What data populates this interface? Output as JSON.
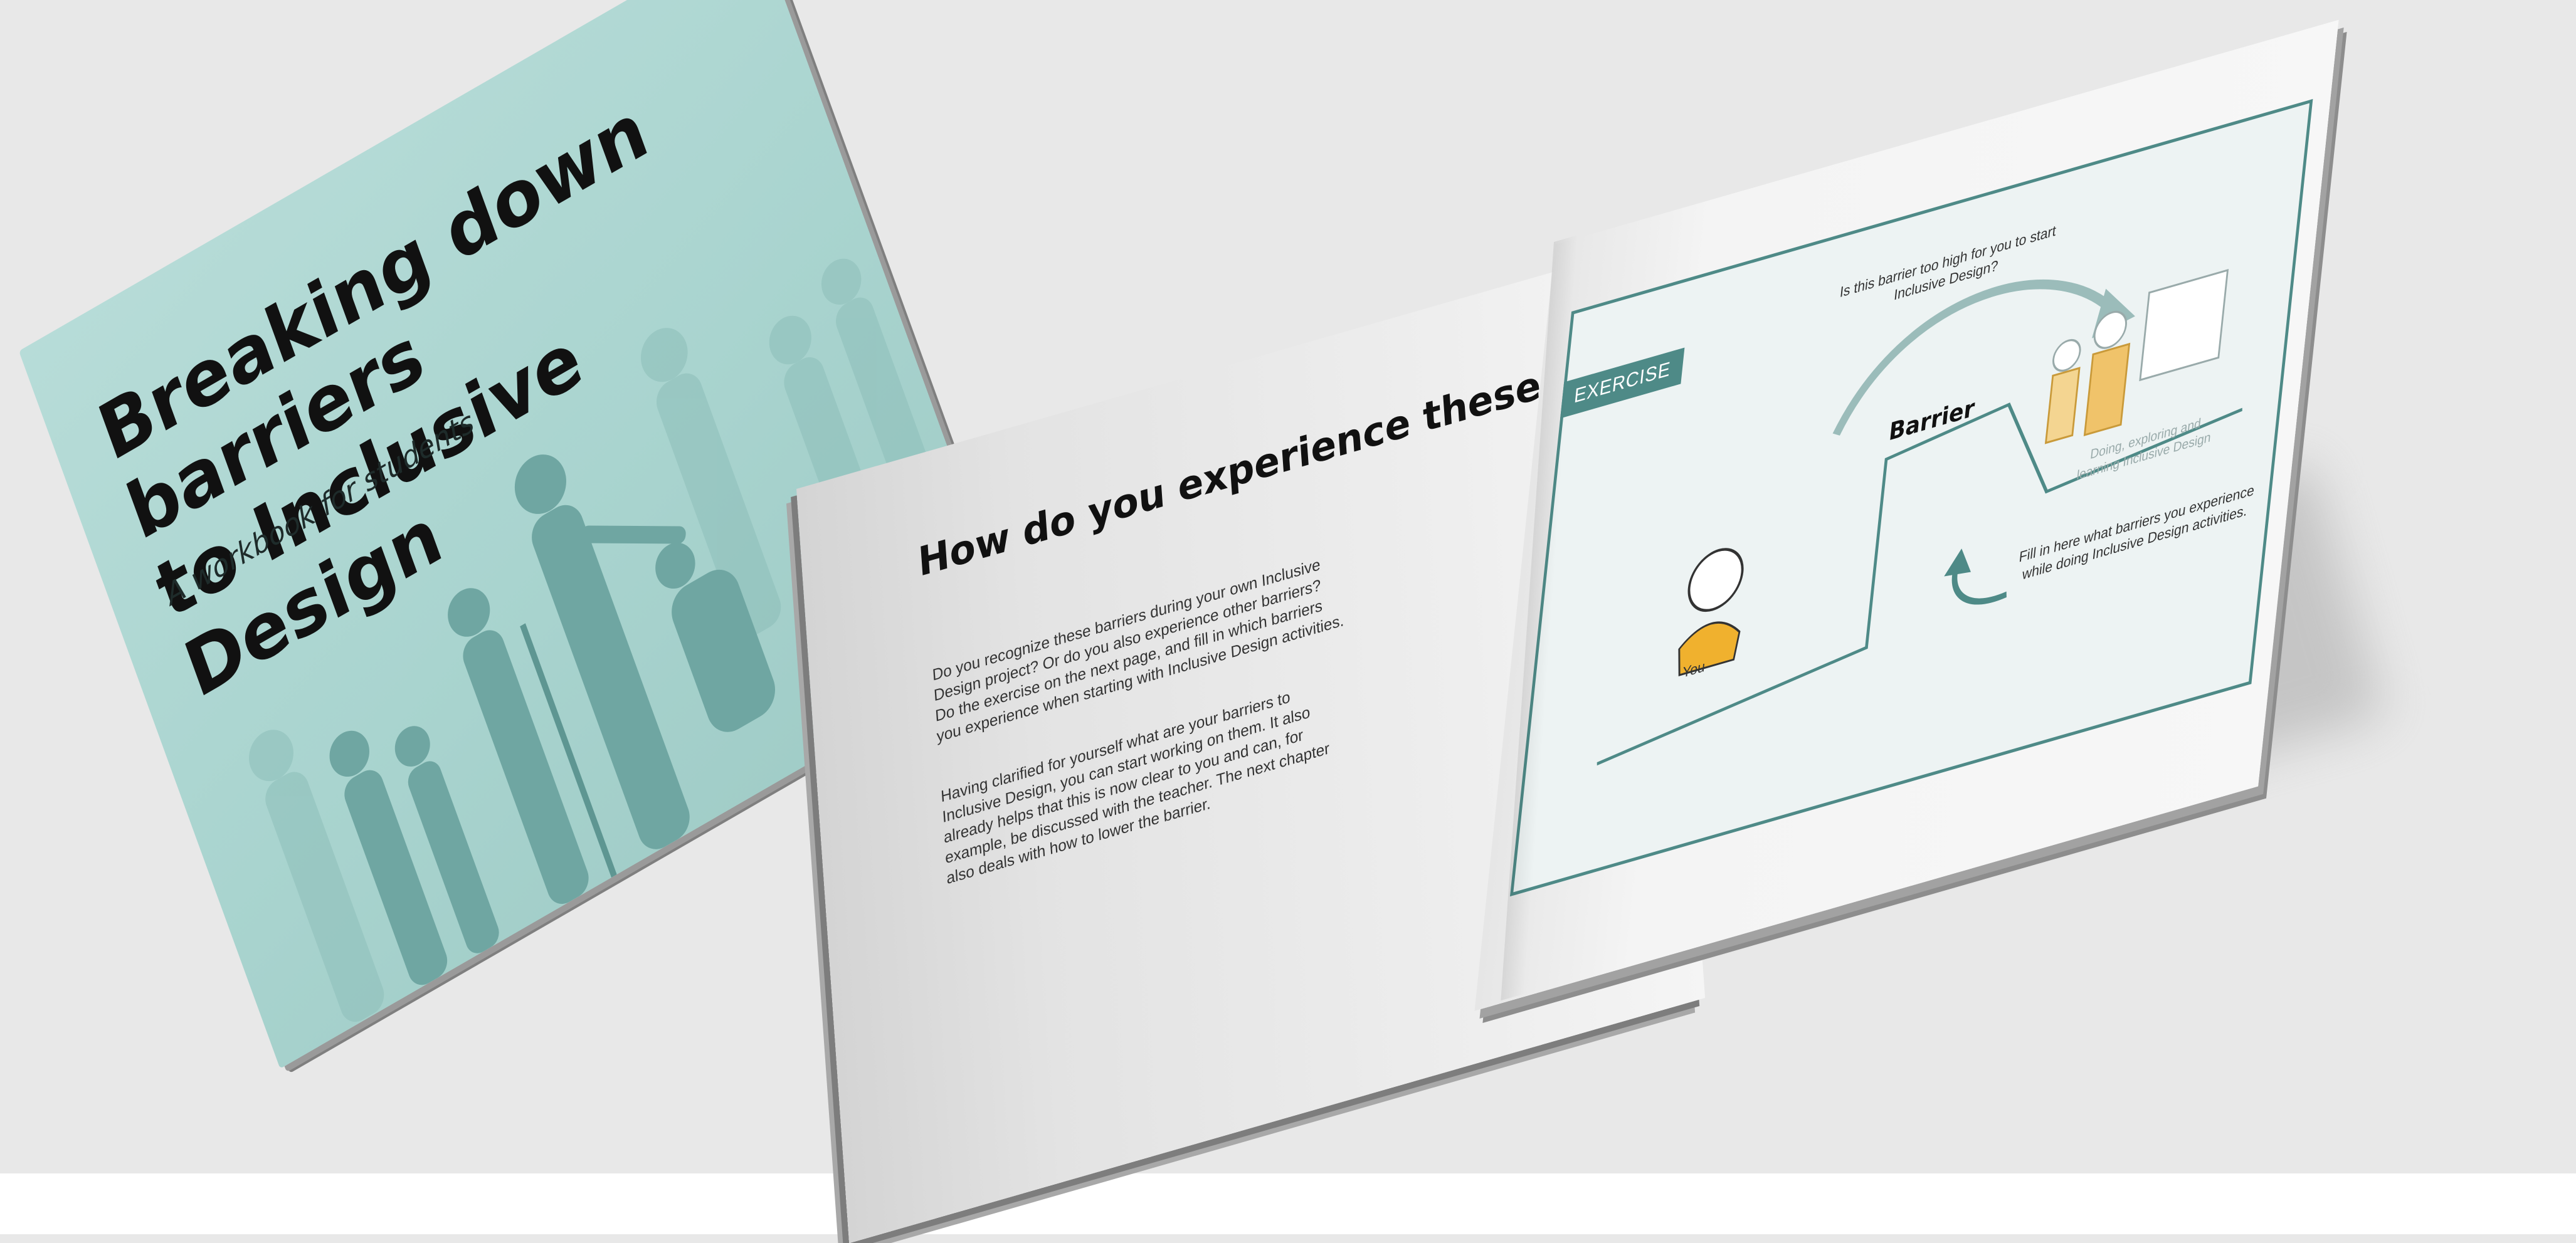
{
  "cover": {
    "title": "Breaking down barriers\nto Inclusive Design",
    "subtitle": "A workbook for students"
  },
  "spread": {
    "left_page": {
      "heading": "How do you experience these barriers?",
      "paragraph_1": "Do you recognize these barriers during your own Inclusive Design project? Or do you also experience other barriers? Do the exercise on the next page, and fill in which barriers you experience when starting with Inclusive Design activities.",
      "paragraph_2": "Having clarified for yourself what are your barriers to Inclusive Design, you can start working on them. It also already helps that this is now clear to you and can, for example, be discussed with the teacher. The next chapter also deals with how to lower the barrier."
    },
    "right_page": {
      "exercise_tag": "EXERCISE",
      "question": "Is this barrier too high for you to start Inclusive Design?",
      "barrier_label": "Barrier",
      "doing_label": "Doing, exploring and learning Inclusive Design",
      "you_label": "You",
      "fill_in_label": "Fill in here what barriers you experience while doing Inclusive Design activities."
    }
  },
  "colors": {
    "cover_teal": "#aad4cf",
    "silhouette": "#6fa6a2",
    "exercise_teal": "#4e8a87",
    "person_yellow": "#f0b12e"
  }
}
